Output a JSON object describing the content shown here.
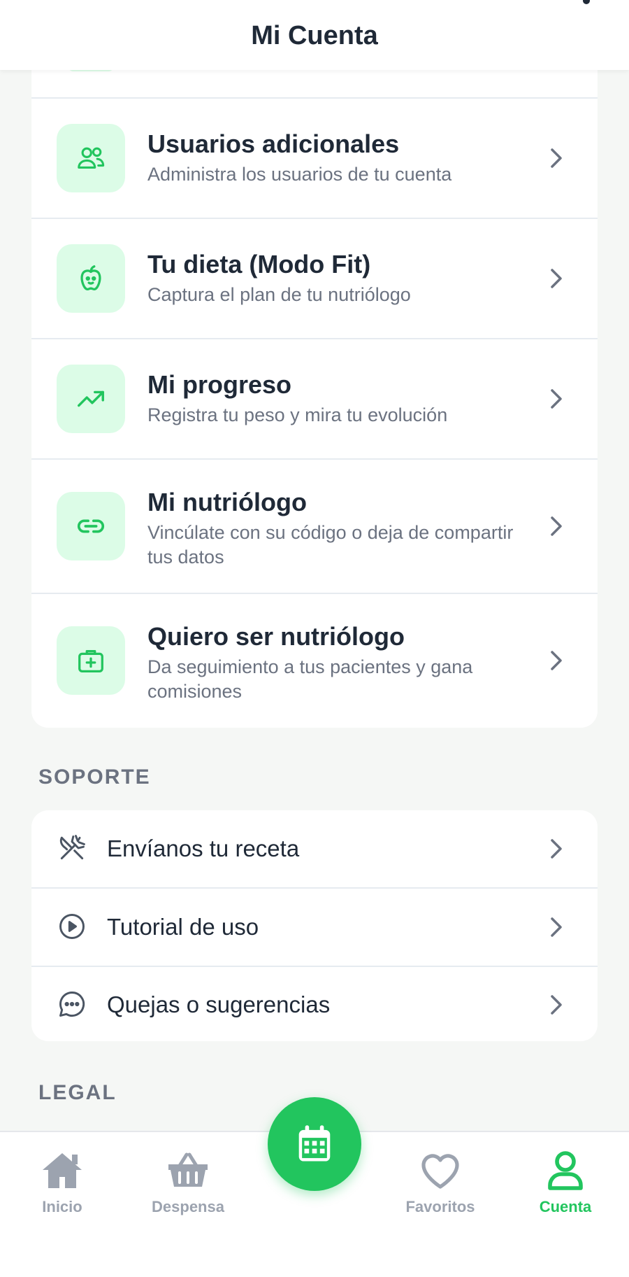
{
  "header": {
    "title": "Mi Cuenta"
  },
  "account_items": [
    {
      "icon": "users-icon",
      "title": "Usuarios adicionales",
      "subtitle": "Administra los usuarios de tu cuenta"
    },
    {
      "icon": "apple-icon",
      "title": "Tu dieta (Modo Fit)",
      "subtitle": "Captura el plan de tu nutriólogo"
    },
    {
      "icon": "trend-up-icon",
      "title": "Mi progreso",
      "subtitle": "Registra tu peso y mira tu evolución"
    },
    {
      "icon": "link-icon",
      "title": "Mi nutriólogo",
      "subtitle": "Vincúlate con su código o deja de compartir tus datos"
    },
    {
      "icon": "medical-case-icon",
      "title": "Quiero ser nutriólogo",
      "subtitle": "Da seguimiento a tus pacientes y gana comisiones"
    }
  ],
  "support": {
    "label": "SOPORTE",
    "items": [
      {
        "icon": "utensils-icon",
        "label": "Envíanos tu receta"
      },
      {
        "icon": "play-circle-icon",
        "label": "Tutorial de uso"
      },
      {
        "icon": "chat-bubble-icon",
        "label": "Quejas o sugerencias"
      }
    ]
  },
  "legal": {
    "label": "LEGAL"
  },
  "nav": {
    "items": [
      {
        "icon": "home-icon",
        "label": "Inicio",
        "active": false
      },
      {
        "icon": "basket-icon",
        "label": "Despensa",
        "active": false
      },
      {
        "icon": "heart-icon",
        "label": "Favoritos",
        "active": false
      },
      {
        "icon": "user-icon",
        "label": "Cuenta",
        "active": true
      }
    ],
    "fab_icon": "calendar-icon"
  },
  "colors": {
    "accent": "#22c55e",
    "icon_bg": "#dcfce7",
    "text_primary": "#1f2937",
    "text_secondary": "#6b7280",
    "nav_inactive": "#9ca3af"
  }
}
